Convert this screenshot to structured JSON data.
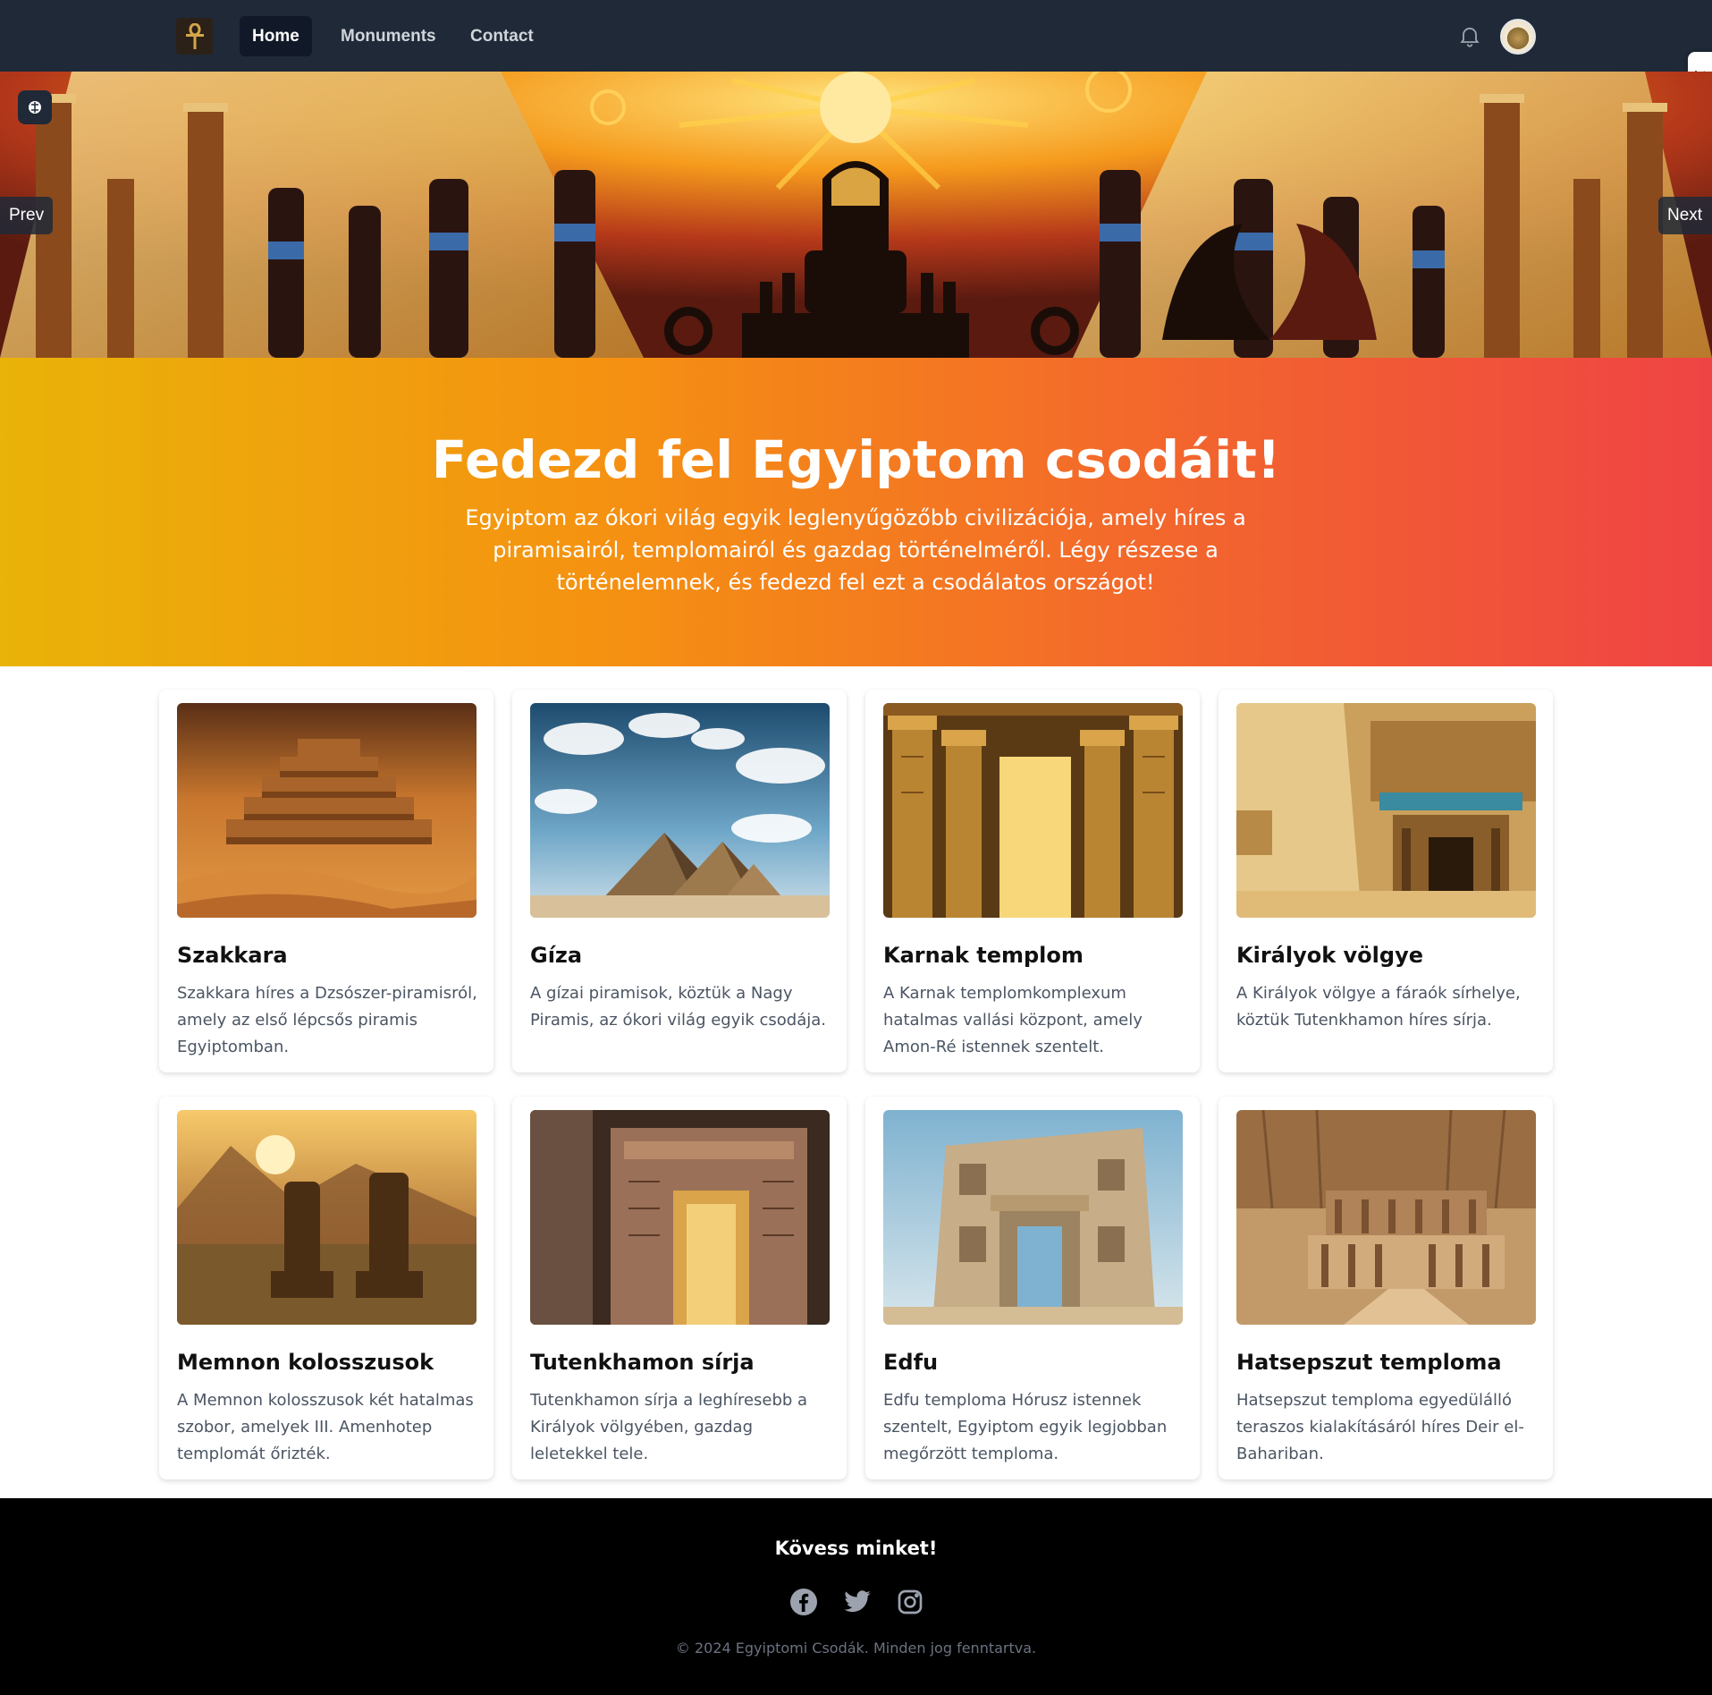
{
  "nav": {
    "logo_icon": "ankh-icon",
    "links": [
      {
        "label": "Home",
        "active": true
      },
      {
        "label": "Monuments",
        "active": false
      },
      {
        "label": "Contact",
        "active": false
      }
    ],
    "bell_icon": "bell-icon",
    "avatar_icon": "user-avatar"
  },
  "carousel": {
    "prev_label": "Prev",
    "next_label": "Next"
  },
  "hero": {
    "title": "Fedezd fel Egyiptom csodáit!",
    "subtitle": "Egyiptom az ókori világ egyik leglenyűgözőbb civilizációja, amely híres a piramisairól, templomairól és gazdag történelméről. Légy részese a történelemnek, és fedezd fel ezt a csodálatos országot!"
  },
  "cards": [
    {
      "title": "Szakkara",
      "text": "Szakkara híres a Dzsószer-piramisról, amely az első lépcsős piramis Egyiptomban."
    },
    {
      "title": "Gíza",
      "text": "A gízai piramisok, köztük a Nagy Piramis, az ókori világ egyik csodája."
    },
    {
      "title": "Karnak templom",
      "text": "A Karnak templomkomplexum hatalmas vallási központ, amely Amon-Ré istennek szentelt."
    },
    {
      "title": "Királyok völgye",
      "text": "A Királyok völgye a fáraók sírhelye, köztük Tutenkhamon híres sírja."
    },
    {
      "title": "Memnon kolosszusok",
      "text": "A Memnon kolosszusok két hatalmas szobor, amelyek III. Amenhotep templomát őrizték."
    },
    {
      "title": "Tutenkhamon sírja",
      "text": "Tutenkhamon sírja a leghíresebb a Királyok völgyében, gazdag leletekkel tele."
    },
    {
      "title": "Edfu",
      "text": "Edfu temploma Hórusz istennek szentelt, Egyiptom egyik legjobban megőrzött temploma."
    },
    {
      "title": "Hatsepszut temploma",
      "text": "Hatsepszut temploma egyedülálló teraszos kialakításáról híres Deir el-Bahariban."
    }
  ],
  "footer": {
    "follow_title": "Kövess minket!",
    "social_icons": [
      "facebook-icon",
      "twitter-icon",
      "instagram-icon"
    ],
    "copyright": "© 2024 Egyiptomi Csodák. Minden jog fenntartva."
  },
  "colors": {
    "nav_bg": "#1f2937",
    "gradient_start": "#e9b308",
    "gradient_mid": "#f59211",
    "gradient_end": "#ef4444",
    "footer_bg": "#000000"
  }
}
